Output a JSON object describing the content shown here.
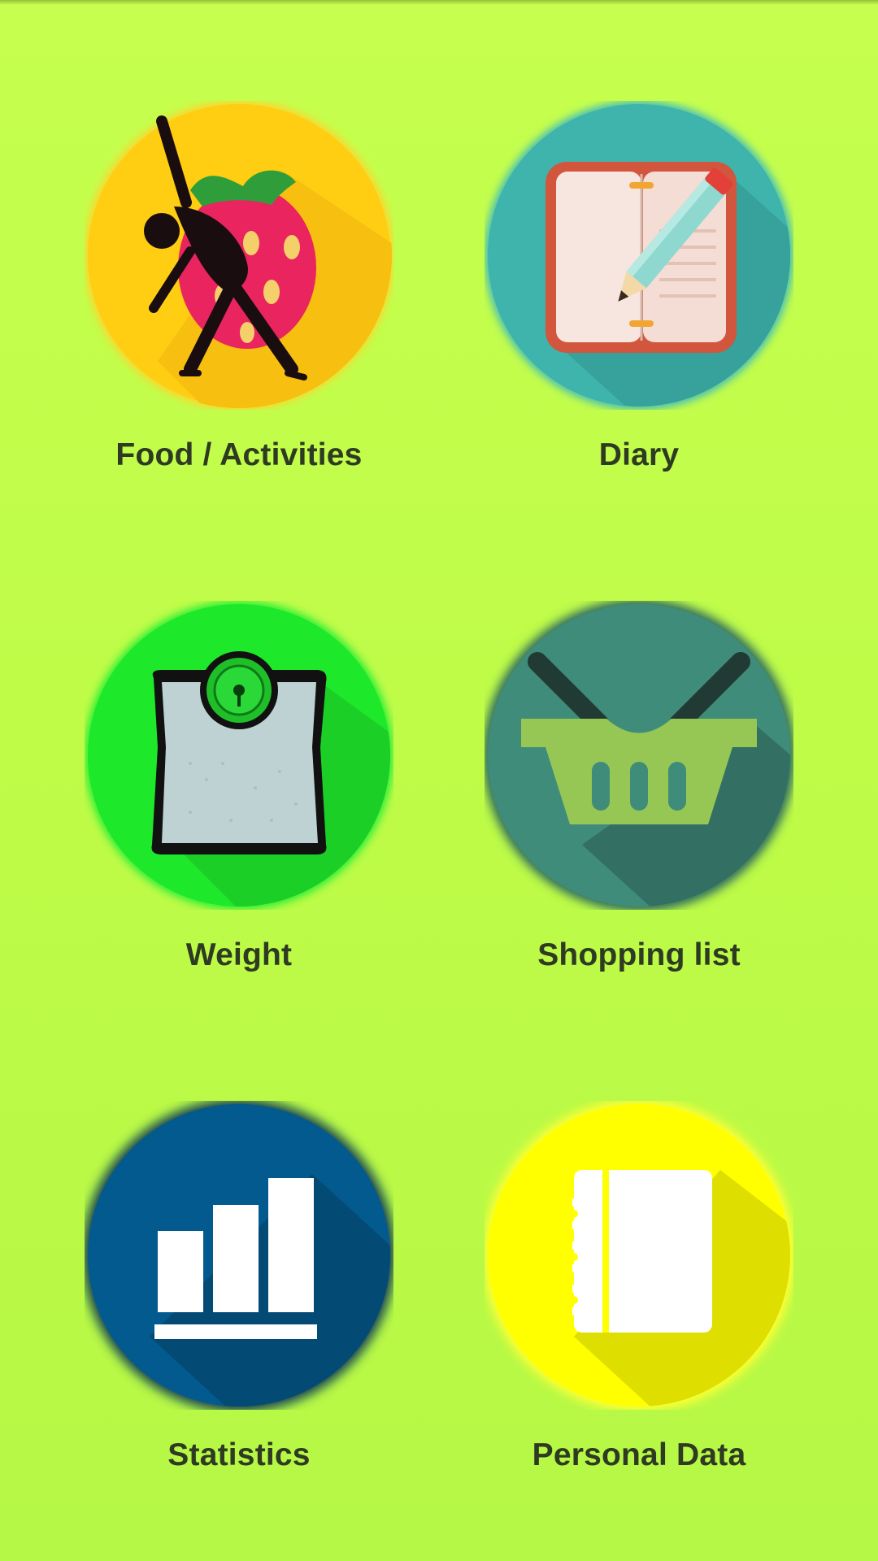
{
  "menu": {
    "items": [
      {
        "id": "food-activities",
        "label": "Food / Activities",
        "icon": "strawberry-exercise-icon",
        "circle_color": "#ffcd11"
      },
      {
        "id": "diary",
        "label": "Diary",
        "icon": "notebook-pencil-icon",
        "circle_color": "#3eb4ad"
      },
      {
        "id": "weight",
        "label": "Weight",
        "icon": "bathroom-scale-icon",
        "circle_color": "#1ee82a"
      },
      {
        "id": "shopping-list",
        "label": "Shopping list",
        "icon": "shopping-basket-icon",
        "circle_color": "#3f8c7a"
      },
      {
        "id": "statistics",
        "label": "Statistics",
        "icon": "bar-chart-icon",
        "circle_color": "#035a8f"
      },
      {
        "id": "personal-data",
        "label": "Personal Data",
        "icon": "spiral-notebook-icon",
        "circle_color": "#ffff00"
      }
    ]
  },
  "colors": {
    "background": "#c0fc4a",
    "label_text": "#2e3a22"
  }
}
